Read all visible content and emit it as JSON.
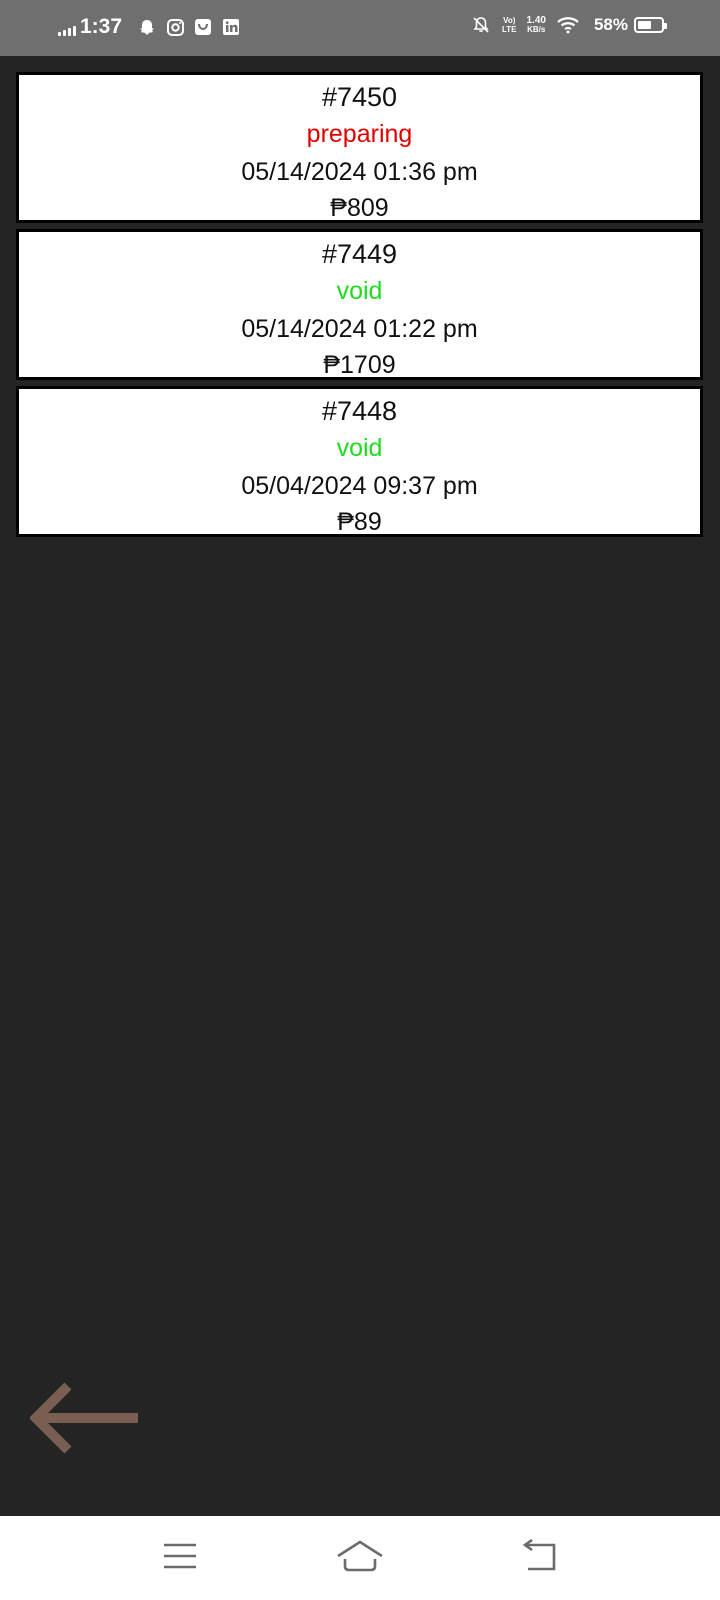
{
  "status_bar": {
    "time": "1:37",
    "network_speed": "1.40",
    "network_unit": "KB/s",
    "network_type_top": "Vo)",
    "network_type_bottom": "LTE",
    "battery_percent": "58%",
    "battery_level": 0.58,
    "app_icons": [
      "snapchat-icon",
      "instagram-icon",
      "shopping-bag-icon",
      "linkedin-icon"
    ]
  },
  "orders": [
    {
      "number": "#7450",
      "status": "preparing",
      "status_color": "#e00000",
      "datetime": "05/14/2024 01:36 pm",
      "total": "₱809"
    },
    {
      "number": "#7449",
      "status": "void",
      "status_color": "#1fdc1f",
      "datetime": "05/14/2024 01:22 pm",
      "total": "₱1709"
    },
    {
      "number": "#7448",
      "status": "void",
      "status_color": "#1fdc1f",
      "datetime": "05/04/2024 09:37 pm",
      "total": "₱89"
    }
  ],
  "colors": {
    "background": "#242424",
    "status_bar": "#6f6f6f",
    "back_arrow": "#7a5e52",
    "nav_icons": "#6b6b6b"
  },
  "nav": {
    "menu_icon": "menu-icon",
    "home_icon": "home-icon",
    "back_icon": "back-icon"
  }
}
